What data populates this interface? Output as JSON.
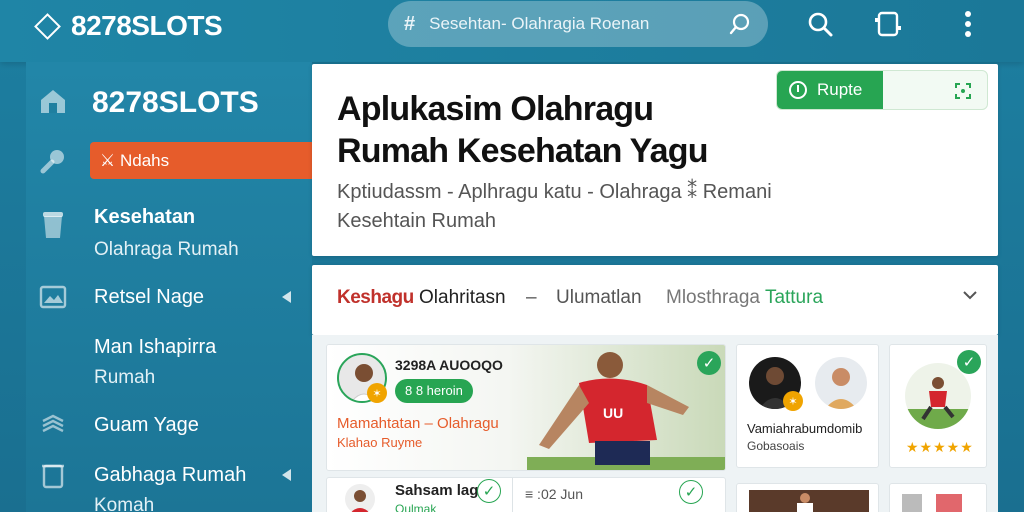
{
  "topbar": {
    "brand": "8278SLOTS",
    "search_hash": "#",
    "search_placeholder": "Sesehtan- Olahragia Roenan"
  },
  "sidebar": {
    "brand": "8278SLOTS",
    "active_item": "⚔ Ndahs",
    "items": [
      {
        "title": "Kesehatan",
        "subtitle": "Olahraga Rumah"
      },
      {
        "title": "Retsel Nage"
      },
      {
        "title": "Man Ishapirra",
        "subtitle": "Rumah"
      },
      {
        "title": "Guam Yage"
      },
      {
        "title": "Gabhaga Rumah",
        "subtitle": "Komah"
      }
    ]
  },
  "hero": {
    "title_line1": "Aplukasim Olahragu",
    "title_line2": "Rumah Kesehatan Yagu",
    "sub_line1": "Kptiudassm - Aplhragu katu - Olahraga ⁑ Remani",
    "sub_line2": "Kesehtain Rumah",
    "pill_label": "Rupte"
  },
  "tabs": {
    "tab1": "Keshagu",
    "tab1b": "Olahritasn",
    "dash": "–",
    "tab2": "Ulumatlan",
    "tab3a": "Mlosthraga",
    "tab3b": "Tattura"
  },
  "tiles": {
    "main": {
      "title": "3298A AUOOQO",
      "badge": "8 8 heroin",
      "line1": "Mamahtatan – Olahragu",
      "line2": "Klahao Ruyme",
      "jersey": "UU"
    },
    "second": {
      "title": "Vamiahrabumdomib",
      "subtitle": "Gobasoais"
    },
    "third": {
      "stars": "★★★★★"
    },
    "row2a": {
      "title": "Sahsam lag",
      "subtitle": "Oulmak"
    },
    "row2b": {
      "label": "≡ :02 Jun"
    }
  },
  "colors": {
    "accent_orange": "#e65c2b",
    "accent_green": "#27a552",
    "brand_teal": "#1d7fa1"
  }
}
